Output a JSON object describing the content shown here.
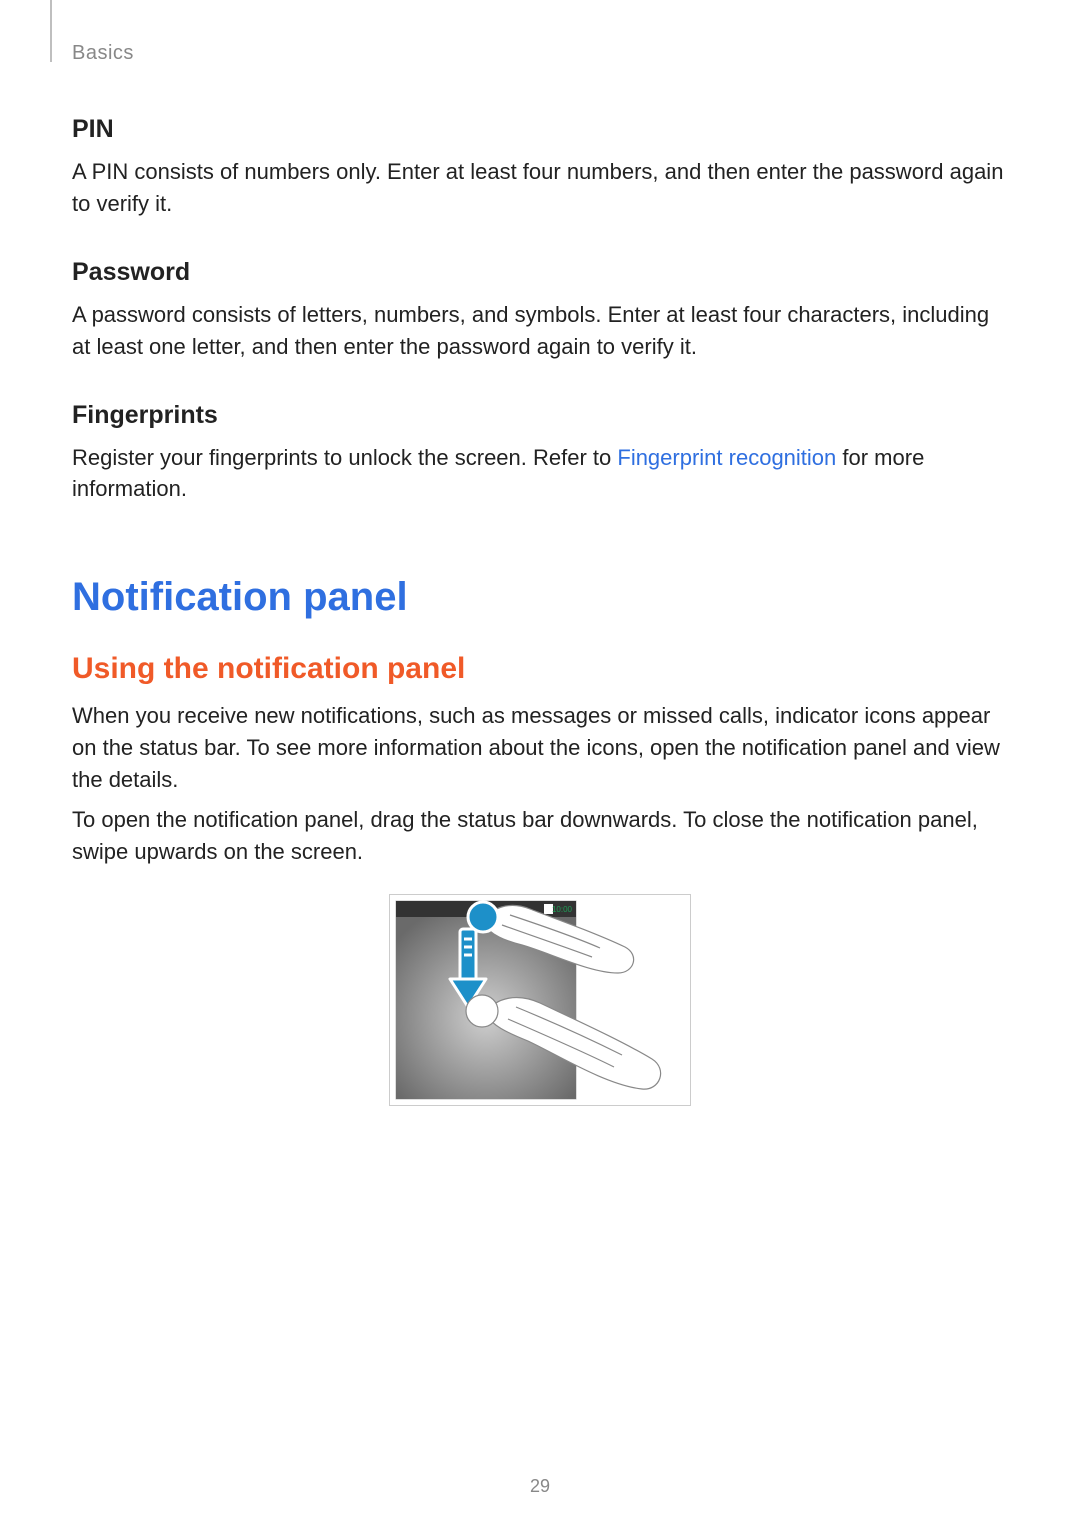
{
  "breadcrumb": "Basics",
  "sections": {
    "pin": {
      "heading": "PIN",
      "body": "A PIN consists of numbers only. Enter at least four numbers, and then enter the password again to verify it."
    },
    "password": {
      "heading": "Password",
      "body": "A password consists of letters, numbers, and symbols. Enter at least four characters, including at least one letter, and then enter the password again to verify it."
    },
    "fingerprints": {
      "heading": "Fingerprints",
      "body_pre": "Register your fingerprints to unlock the screen. Refer to ",
      "link": "Fingerprint recognition",
      "body_post": " for more information."
    }
  },
  "h1": "Notification panel",
  "h2": "Using the notification panel",
  "p1": "When you receive new notifications, such as messages or missed calls, indicator icons appear on the status bar. To see more information about the icons, open the notification panel and view the details.",
  "p2": "To open the notification panel, drag the status bar downwards. To close the notification panel, swipe upwards on the screen.",
  "illustration": {
    "status_time": "10:00",
    "alt": "swipe-down-gesture"
  },
  "page_number": "29"
}
